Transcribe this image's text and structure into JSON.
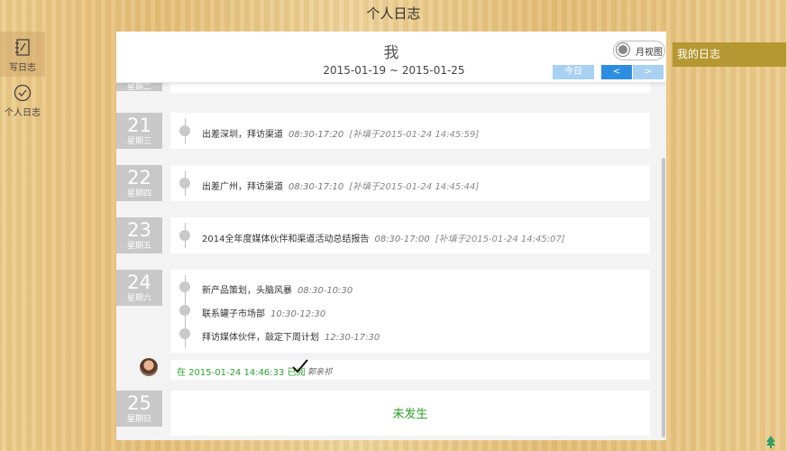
{
  "window": {
    "title": "个人日志"
  },
  "sidebar": {
    "items": [
      {
        "label": "写日志",
        "icon": "notebook-icon",
        "active": true
      },
      {
        "label": "个人日志",
        "icon": "clock-icon",
        "active": false
      }
    ]
  },
  "header": {
    "user": "我",
    "range": "2015-01-19 ~ 2015-01-25",
    "view_toggle_label": "月视图",
    "today_label": "今日",
    "prev_label": "<",
    "next_label": ">"
  },
  "days": [
    {
      "partial_label": "星期二"
    },
    {
      "num": "21",
      "weekday": "星期三",
      "entries": [
        {
          "title": "出差深圳，拜访渠道",
          "time": "08:30-17:20",
          "note": "[补填于2015-01-24 14:45:59]"
        }
      ]
    },
    {
      "num": "22",
      "weekday": "星期四",
      "entries": [
        {
          "title": "出差广州，拜访渠道",
          "time": "08:30-17:10",
          "note": "[补填于2015-01-24 14:45:44]"
        }
      ]
    },
    {
      "num": "23",
      "weekday": "星期五",
      "entries": [
        {
          "title": "2014全年度媒体伙伴和渠道活动总结报告",
          "time": "08:30-17:00",
          "note": "[补填于2015-01-24 14:45:07]"
        }
      ]
    },
    {
      "num": "24",
      "weekday": "星期六",
      "entries": [
        {
          "title": "新产品策划，头脑风暴",
          "time": "08:30-10:30"
        },
        {
          "title": "联系罐子市场部",
          "time": "10:30-12:30"
        },
        {
          "title": "拜访媒体伙伴，敲定下周计划",
          "time": "12:30-17:30"
        }
      ],
      "read": {
        "text": "在 2015-01-24 14:46:33 已阅",
        "reader": "郭亲祁"
      }
    },
    {
      "num": "25",
      "weekday": "星期日",
      "empty_text": "未发生"
    }
  ],
  "right_panel": {
    "tab_label": "我的日志"
  },
  "colors": {
    "accent": "#2d8ee1",
    "tab_gold": "#b59831",
    "read_green": "#2aa32a"
  }
}
